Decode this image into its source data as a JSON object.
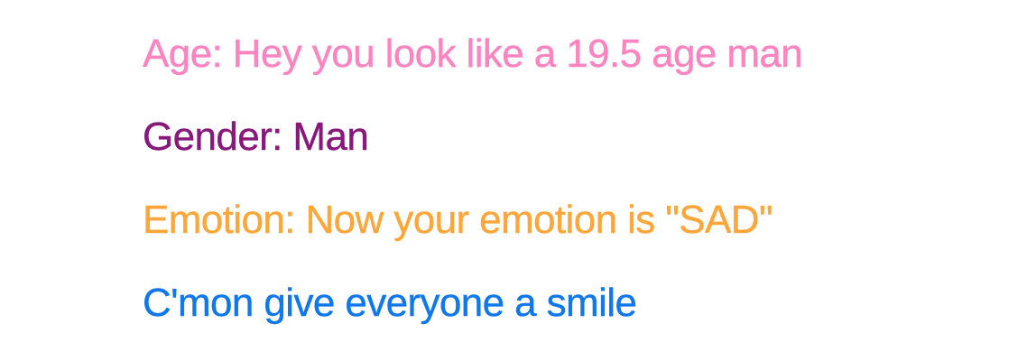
{
  "result": {
    "age_text": "Age: Hey you look like a 19.5 age man",
    "gender_text": "Gender: Man",
    "emotion_text": "Emotion: Now your emotion is \"SAD\"",
    "message_text": "C'mon give everyone a smile"
  },
  "colors": {
    "age": "#ff84c0",
    "gender": "#88197c",
    "emotion": "#ffa63a",
    "message": "#1178ec",
    "background": "#ffffff"
  }
}
